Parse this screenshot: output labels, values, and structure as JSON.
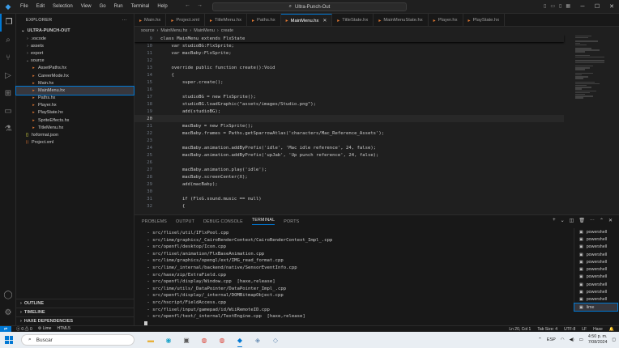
{
  "titlebar": {
    "menu": [
      "File",
      "Edit",
      "Selection",
      "View",
      "Go",
      "Run",
      "Terminal",
      "Help"
    ],
    "search_text": "Ultra-Punch-Out"
  },
  "sidebar": {
    "header": "EXPLORER",
    "root": "ULTRA-PUNCH-OUT",
    "items": [
      {
        "label": ".vscode",
        "type": "folder",
        "expanded": false
      },
      {
        "label": "assets",
        "type": "folder",
        "expanded": false
      },
      {
        "label": "export",
        "type": "folder",
        "expanded": false
      },
      {
        "label": "source",
        "type": "folder",
        "expanded": true
      },
      {
        "label": "AssetPaths.hx",
        "type": "hx",
        "indent": true
      },
      {
        "label": "CareerMode.hx",
        "type": "hx",
        "indent": true
      },
      {
        "label": "Main.hx",
        "type": "hx",
        "indent": true
      },
      {
        "label": "MainMenu.hx",
        "type": "hx",
        "indent": true,
        "selected": true
      },
      {
        "label": "Paths.hx",
        "type": "hx",
        "indent": true
      },
      {
        "label": "Player.hx",
        "type": "hx",
        "indent": true
      },
      {
        "label": "PlayState.hx",
        "type": "hx",
        "indent": true
      },
      {
        "label": "SpriteEffects.hx",
        "type": "hx",
        "indent": true
      },
      {
        "label": "TitleMenu.hx",
        "type": "hx",
        "indent": true
      },
      {
        "label": "hxformat.json",
        "type": "json"
      },
      {
        "label": "Project.xml",
        "type": "xml"
      }
    ],
    "sections": [
      "OUTLINE",
      "TIMELINE",
      "HAXE DEPENDENCIES"
    ]
  },
  "tabs": [
    {
      "label": "Main.hx",
      "active": false
    },
    {
      "label": "Project.xml",
      "active": false
    },
    {
      "label": "TitleMenu.hx",
      "active": false
    },
    {
      "label": "Paths.hx",
      "active": false
    },
    {
      "label": "MainMenu.hx",
      "active": true
    },
    {
      "label": "TitleState.hx",
      "active": false
    },
    {
      "label": "MainMenuState.hx",
      "active": false
    },
    {
      "label": "Player.hx",
      "active": false
    },
    {
      "label": "PlayState.hx",
      "active": false
    }
  ],
  "breadcrumb": [
    "source",
    "MainMenu.hx",
    "MainMenu",
    "create"
  ],
  "editor": {
    "sticky": {
      "num": "9",
      "text": "class MainMenu extends FlxState"
    },
    "lines": [
      {
        "num": "10",
        "text": "    var studioBG:FlxSprite;"
      },
      {
        "num": "11",
        "text": "    var macBaby:FlxSprite;"
      },
      {
        "num": "12",
        "text": ""
      },
      {
        "num": "13",
        "text": "    override public function create():Void"
      },
      {
        "num": "14",
        "text": "    {"
      },
      {
        "num": "15",
        "text": "        super.create();"
      },
      {
        "num": "16",
        "text": ""
      },
      {
        "num": "17",
        "text": "        studioBG = new FlxSprite();"
      },
      {
        "num": "18",
        "text": "        studioBG.loadGraphic(\"assets/images/Studio.png\");"
      },
      {
        "num": "19",
        "text": "        add(studioBG);"
      },
      {
        "num": "20",
        "text": ""
      },
      {
        "num": "21",
        "text": "        macBaby = new FlxSprite();"
      },
      {
        "num": "22",
        "text": "        macBaby.frames = Paths.getSparrowAtlas('characters/Mac_Reference_Assets');"
      },
      {
        "num": "23",
        "text": ""
      },
      {
        "num": "24",
        "text": "        macBaby.animation.addByPrefix('idle', 'Mac idle reference', 24, false);"
      },
      {
        "num": "25",
        "text": "        macBaby.animation.addByPrefix('upJab', 'Up punch reference', 24, false);"
      },
      {
        "num": "26",
        "text": ""
      },
      {
        "num": "27",
        "text": "        macBaby.animation.play('idle');"
      },
      {
        "num": "28",
        "text": "        macBaby.screenCenter(X);"
      },
      {
        "num": "29",
        "text": "        add(macBaby);"
      },
      {
        "num": "30",
        "text": ""
      },
      {
        "num": "31",
        "text": "        if (FlxG.sound.music == null)"
      },
      {
        "num": "32",
        "text": "        {"
      }
    ]
  },
  "panel": {
    "tabs": [
      "PROBLEMS",
      "OUTPUT",
      "DEBUG CONSOLE",
      "TERMINAL",
      "PORTS"
    ],
    "active_tab": "TERMINAL",
    "terminal_lines": [
      " - src/flixel/util/IFlxPool.cpp",
      " - src/lime/graphics/_CairoRenderContext/CairoRenderContext_Impl_.cpp",
      " - src/openfl/desktop/Icon.cpp",
      " - src/flixel/animation/FlxBaseAnimation.cpp",
      " - src/lime/graphics/opengl/ext/IMG_read_format.cpp",
      " - src/lime/_internal/backend/native/SensorEventInfo.cpp",
      " - src/haxe/zip/ExtraField.cpp",
      " - src/openfl/display/Window.cpp  [haxe,release]",
      " - src/lime/utils/_DataPointer/DataPointer_Impl_.cpp",
      " - src/openfl/display/_internal/DOMBitmapObject.cpp",
      " - src/hscript/FieldAccess.cpp",
      " - src/flixel/input/gamepad/id/WiiRemoteID.cpp",
      " - src/openfl/text/_internal/TextEngine.cpp  [haxe,release]"
    ],
    "terminal_list": [
      "powershell",
      "powershell",
      "powershell",
      "powershell",
      "powershell",
      "powershell",
      "powershell",
      "powershell",
      "powershell",
      "powershell",
      "lime"
    ]
  },
  "statusbar": {
    "errors": "0",
    "warnings": "0",
    "lime": "Lime",
    "target": "HTML5",
    "position": "Ln 20, Col 1",
    "tab_size": "Tab Size: 4",
    "encoding": "UTF-8",
    "eol": "LF",
    "language": "Haxe"
  },
  "taskbar": {
    "search_placeholder": "Buscar",
    "lang": "ESP",
    "time": "4:50 p. m.",
    "date": "7/08/2024"
  }
}
